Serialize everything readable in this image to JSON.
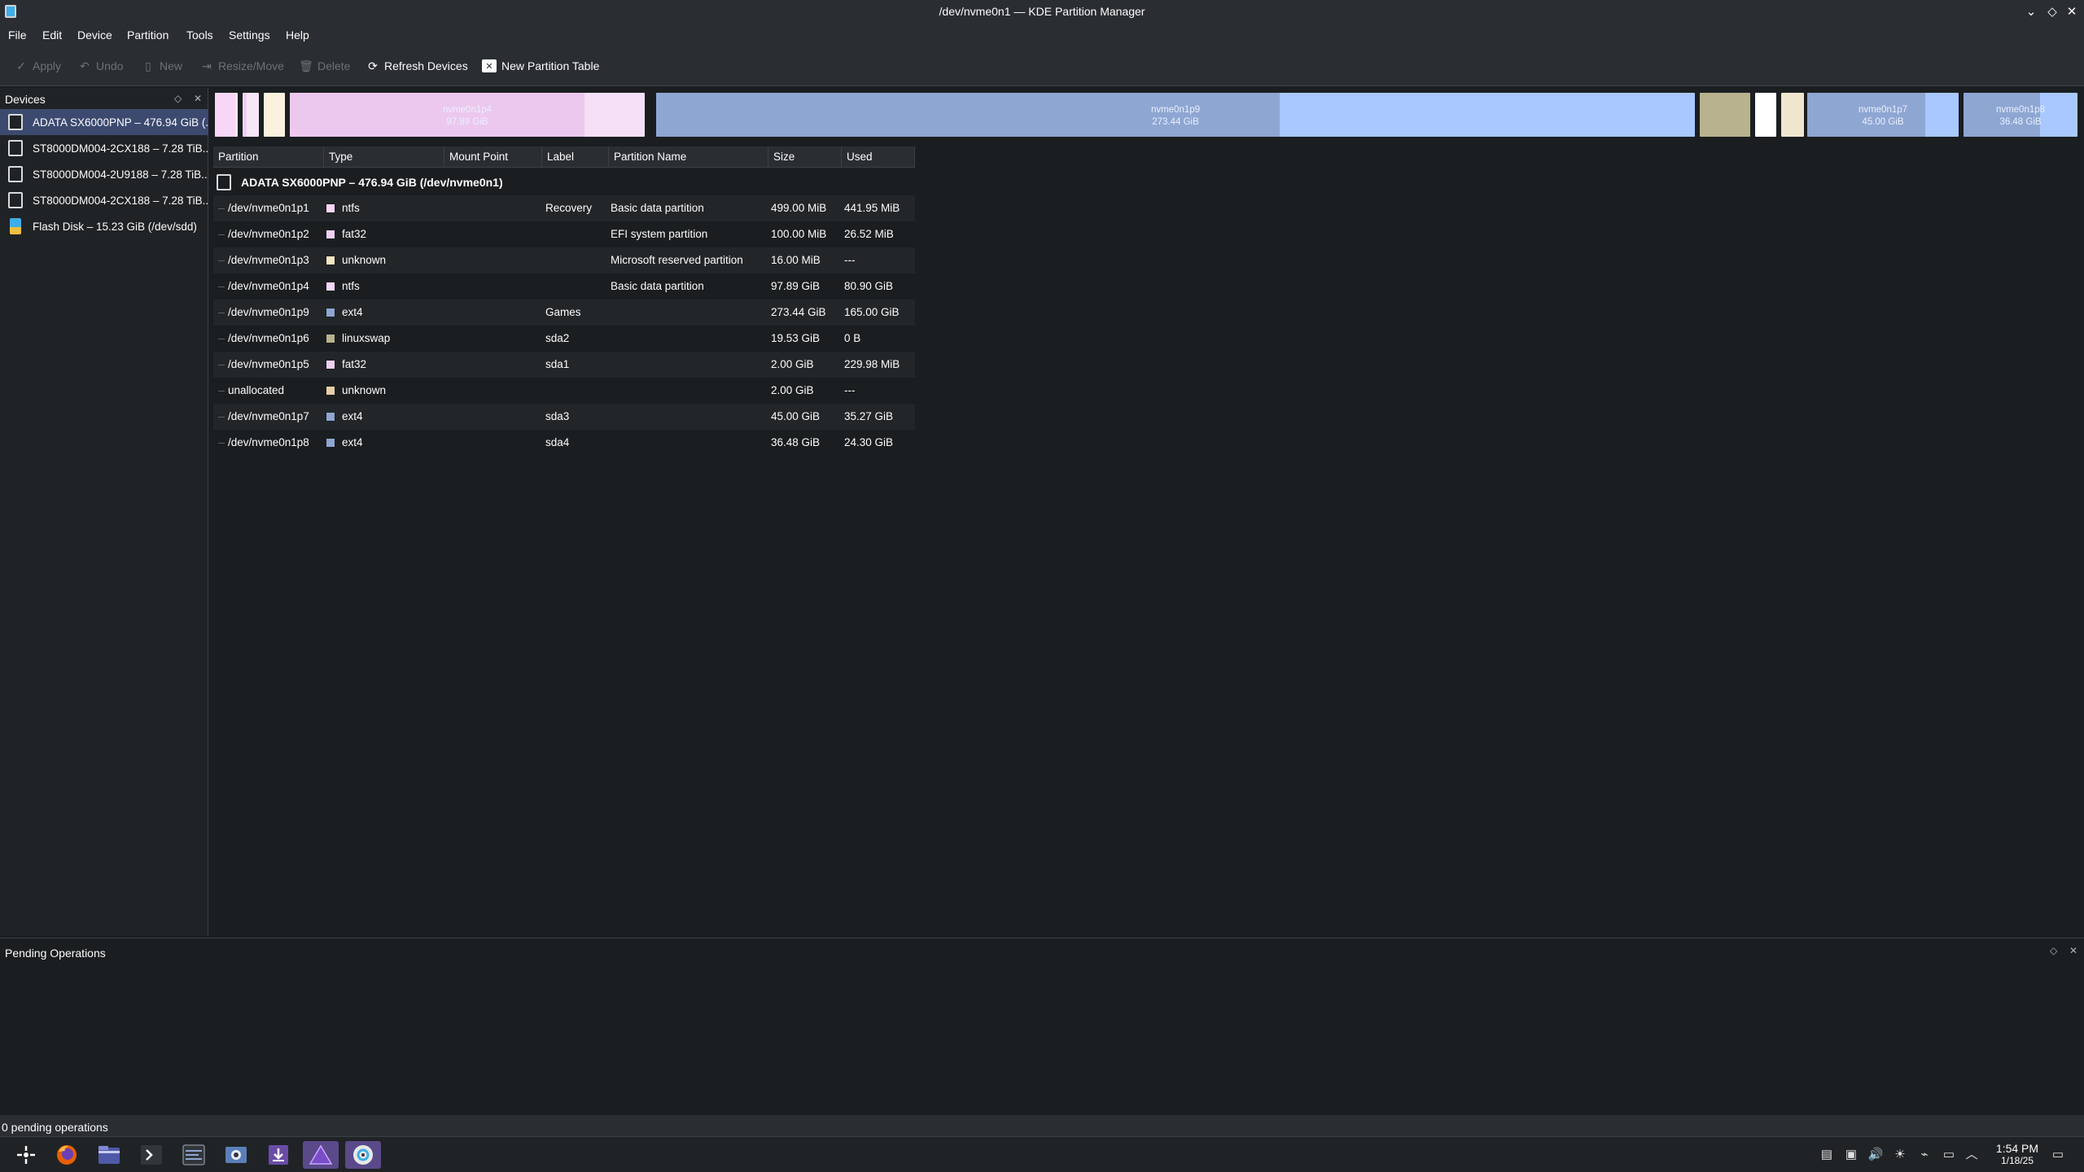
{
  "window": {
    "title": "/dev/nvme0n1 — KDE Partition Manager",
    "controls": [
      "minimize-icon",
      "maximize-icon",
      "close-icon"
    ]
  },
  "menu": {
    "items": [
      "File",
      "Edit",
      "Device",
      "Partition",
      "Tools",
      "Settings",
      "Help"
    ]
  },
  "toolbar": {
    "apply": "Apply",
    "undo": "Undo",
    "new": "New",
    "resize_move": "Resize/Move",
    "delete": "Delete",
    "refresh": "Refresh Devices",
    "new_table": "New Partition Table"
  },
  "devices_panel": {
    "title": "Devices",
    "items": [
      {
        "label": "ADATA SX6000PNP – 476.94 GiB (...",
        "icon": "disk-icon",
        "selected": true
      },
      {
        "label": "ST8000DM004-2CX188 – 7.28 TiB...",
        "icon": "disk-icon"
      },
      {
        "label": "ST8000DM004-2U9188 – 7.28 TiB...",
        "icon": "disk-icon"
      },
      {
        "label": "ST8000DM004-2CX188 – 7.28 TiB...",
        "icon": "disk-icon"
      },
      {
        "label": "Flash Disk – 15.23 GiB (/dev/sdd)",
        "icon": "usb-drive-icon"
      }
    ]
  },
  "partition_bar": {
    "segments": [
      {
        "name": "",
        "size": "",
        "color": "#f7d6f7",
        "used": 0.88
      },
      {
        "name": "",
        "size": "",
        "color": "#f0d0f2",
        "used": 0.27
      },
      {
        "name": "",
        "size": "",
        "color": "#f5e6c3",
        "used": 0
      },
      {
        "name": "nvme0n1p4",
        "size": "97.89 GiB",
        "color": "#ecc7ee",
        "used": 0.83
      },
      {
        "name": "nvme0n1p9",
        "size": "273.44 GiB",
        "color": "#8ea6d2",
        "used": 0.6
      },
      {
        "name": "",
        "size": "",
        "color": "#b8b38e",
        "used": 1
      },
      {
        "name": "",
        "size": "",
        "color": "#ffffff",
        "used": 0
      },
      {
        "name": "",
        "size": "",
        "color": "#e4cfa6",
        "used": 0
      },
      {
        "name": "nvme0n1p7",
        "size": "45.00 GiB",
        "color": "#8ea6d2",
        "used": 0.78
      },
      {
        "name": "nvme0n1p8",
        "size": "36.48 GiB",
        "color": "#8ea6d2",
        "used": 0.67
      }
    ]
  },
  "table": {
    "columns": [
      "Partition",
      "Type",
      "Mount Point",
      "Label",
      "Partition Name",
      "Size",
      "Used"
    ],
    "device_row": "ADATA SX6000PNP – 476.94 GiB (/dev/nvme0n1)",
    "rows": [
      {
        "partition": "/dev/nvme0n1p1",
        "type": "ntfs",
        "color": "#f7d6f7",
        "mount": "",
        "label": "Recovery",
        "name": "Basic data partition",
        "size": "499.00 MiB",
        "used": "441.95 MiB"
      },
      {
        "partition": "/dev/nvme0n1p2",
        "type": "fat32",
        "color": "#f0d0f2",
        "mount": "",
        "label": "",
        "name": "EFI system partition",
        "size": "100.00 MiB",
        "used": "26.52 MiB"
      },
      {
        "partition": "/dev/nvme0n1p3",
        "type": "unknown",
        "color": "#f5e6c3",
        "mount": "",
        "label": "",
        "name": "Microsoft reserved partition",
        "size": "16.00 MiB",
        "used": "---"
      },
      {
        "partition": "/dev/nvme0n1p4",
        "type": "ntfs",
        "color": "#f7d6f7",
        "mount": "",
        "label": "",
        "name": "Basic data partition",
        "size": "97.89 GiB",
        "used": "80.90 GiB"
      },
      {
        "partition": "/dev/nvme0n1p9",
        "type": "ext4",
        "color": "#8ea6d2",
        "mount": "",
        "label": "Games",
        "name": "",
        "size": "273.44 GiB",
        "used": "165.00 GiB"
      },
      {
        "partition": "/dev/nvme0n1p6",
        "type": "linuxswap",
        "color": "#b8b38e",
        "mount": "",
        "label": "sda2",
        "name": "",
        "size": "19.53 GiB",
        "used": "0 B"
      },
      {
        "partition": "/dev/nvme0n1p5",
        "type": "fat32",
        "color": "#f0d0f2",
        "mount": "",
        "label": "sda1",
        "name": "",
        "size": "2.00 GiB",
        "used": "229.98 MiB"
      },
      {
        "partition": "unallocated",
        "type": "unknown",
        "color": "#e4cfa6",
        "mount": "",
        "label": "",
        "name": "",
        "size": "2.00 GiB",
        "used": "---"
      },
      {
        "partition": "/dev/nvme0n1p7",
        "type": "ext4",
        "color": "#8ea6d2",
        "mount": "",
        "label": "sda3",
        "name": "",
        "size": "45.00 GiB",
        "used": "35.27 GiB"
      },
      {
        "partition": "/dev/nvme0n1p8",
        "type": "ext4",
        "color": "#8ea6d2",
        "mount": "",
        "label": "sda4",
        "name": "",
        "size": "36.48 GiB",
        "used": "24.30 GiB"
      }
    ]
  },
  "pending_panel": {
    "title": "Pending Operations"
  },
  "status": {
    "text": "0 pending operations"
  },
  "taskbar": {
    "apps": [
      "app-launcher-icon",
      "firefox-icon",
      "file-manager-icon",
      "terminal-icon",
      "system-monitor-icon",
      "screenshot-icon",
      "downloader-icon",
      "partition-manager-icon",
      "disk-tool-icon"
    ],
    "active_apps": [
      "partition-manager-icon",
      "disk-tool-icon"
    ],
    "tray": [
      "clipboard-icon",
      "storage-icon",
      "volume-icon",
      "brightness-icon",
      "usb-icon",
      "display-icon",
      "tray-expand-icon"
    ],
    "clock_time": "1:54 PM",
    "clock_date": "1/18/25"
  },
  "colors": {
    "selection": "#3c4a70",
    "accent": "#3daee9"
  }
}
